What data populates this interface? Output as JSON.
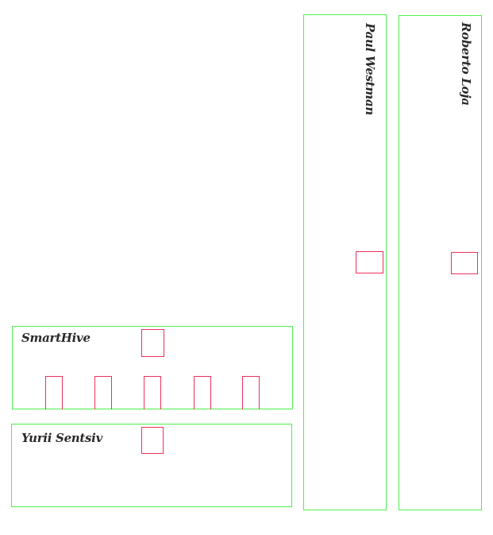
{
  "cards": [
    {
      "title": "SmartHive"
    },
    {
      "title": "Yurii Sentsiv"
    },
    {
      "title": "Paul Westman"
    },
    {
      "title": "Roberto Loja"
    }
  ],
  "colors": {
    "card_border": "#4cf04c",
    "slot_border": "#f0305a",
    "title": "#2a2a2a"
  }
}
